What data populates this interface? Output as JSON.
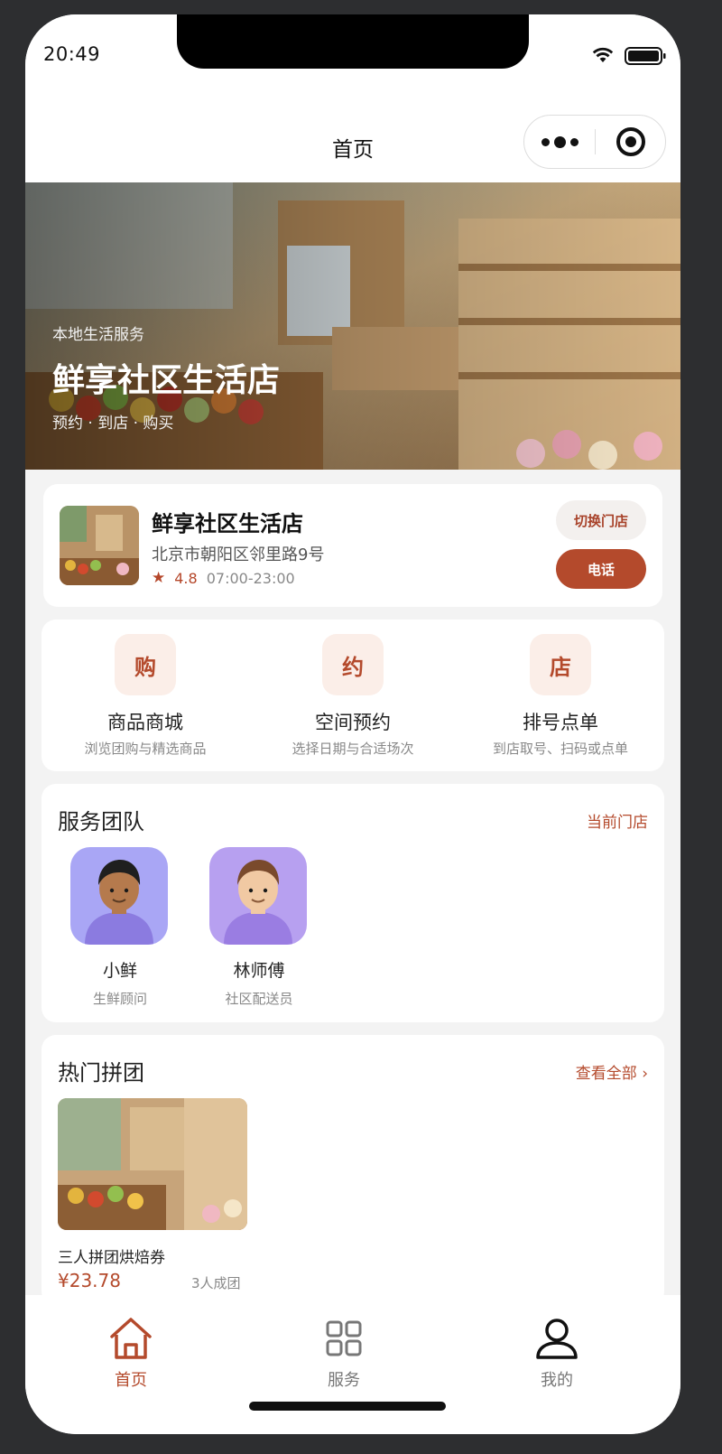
{
  "status": {
    "time": "20:49"
  },
  "nav": {
    "title": "首页"
  },
  "hero": {
    "kicker": "本地生活服务",
    "title": "鲜享社区生活店",
    "subtitle": "预约 · 到店 · 购买"
  },
  "store": {
    "name": "鲜享社区生活店",
    "address": "北京市朝阳区邻里路9号",
    "rating": "4.8",
    "hours": "07:00-23:00",
    "switch_label": "切换门店",
    "call_label": "电话"
  },
  "entries": [
    {
      "badge": "购",
      "title": "商品商城",
      "desc": "浏览团购与精选商品"
    },
    {
      "badge": "约",
      "title": "空间预约",
      "desc": "选择日期与合适场次"
    },
    {
      "badge": "店",
      "title": "排号点单",
      "desc": "到店取号、扫码或点单"
    }
  ],
  "team": {
    "title": "服务团队",
    "link": "当前门店",
    "members": [
      {
        "name": "小鲜",
        "role": "生鲜顾问"
      },
      {
        "name": "林师傅",
        "role": "社区配送员"
      }
    ]
  },
  "groupbuy": {
    "title": "热门拼团",
    "link": "查看全部 ›",
    "items": [
      {
        "name": "三人拼团烘焙券",
        "price": "¥23.78",
        "people": "3人成团"
      }
    ]
  },
  "tabbar": {
    "items": [
      {
        "label": "首页",
        "icon": "home-icon",
        "active": true
      },
      {
        "label": "服务",
        "icon": "grid-icon",
        "active": false
      },
      {
        "label": "我的",
        "icon": "user-icon",
        "active": false
      }
    ]
  },
  "colors": {
    "accent": "#b44a2c",
    "accent_light": "#fbeee8",
    "avatar_bg": "#a9a6f5"
  }
}
